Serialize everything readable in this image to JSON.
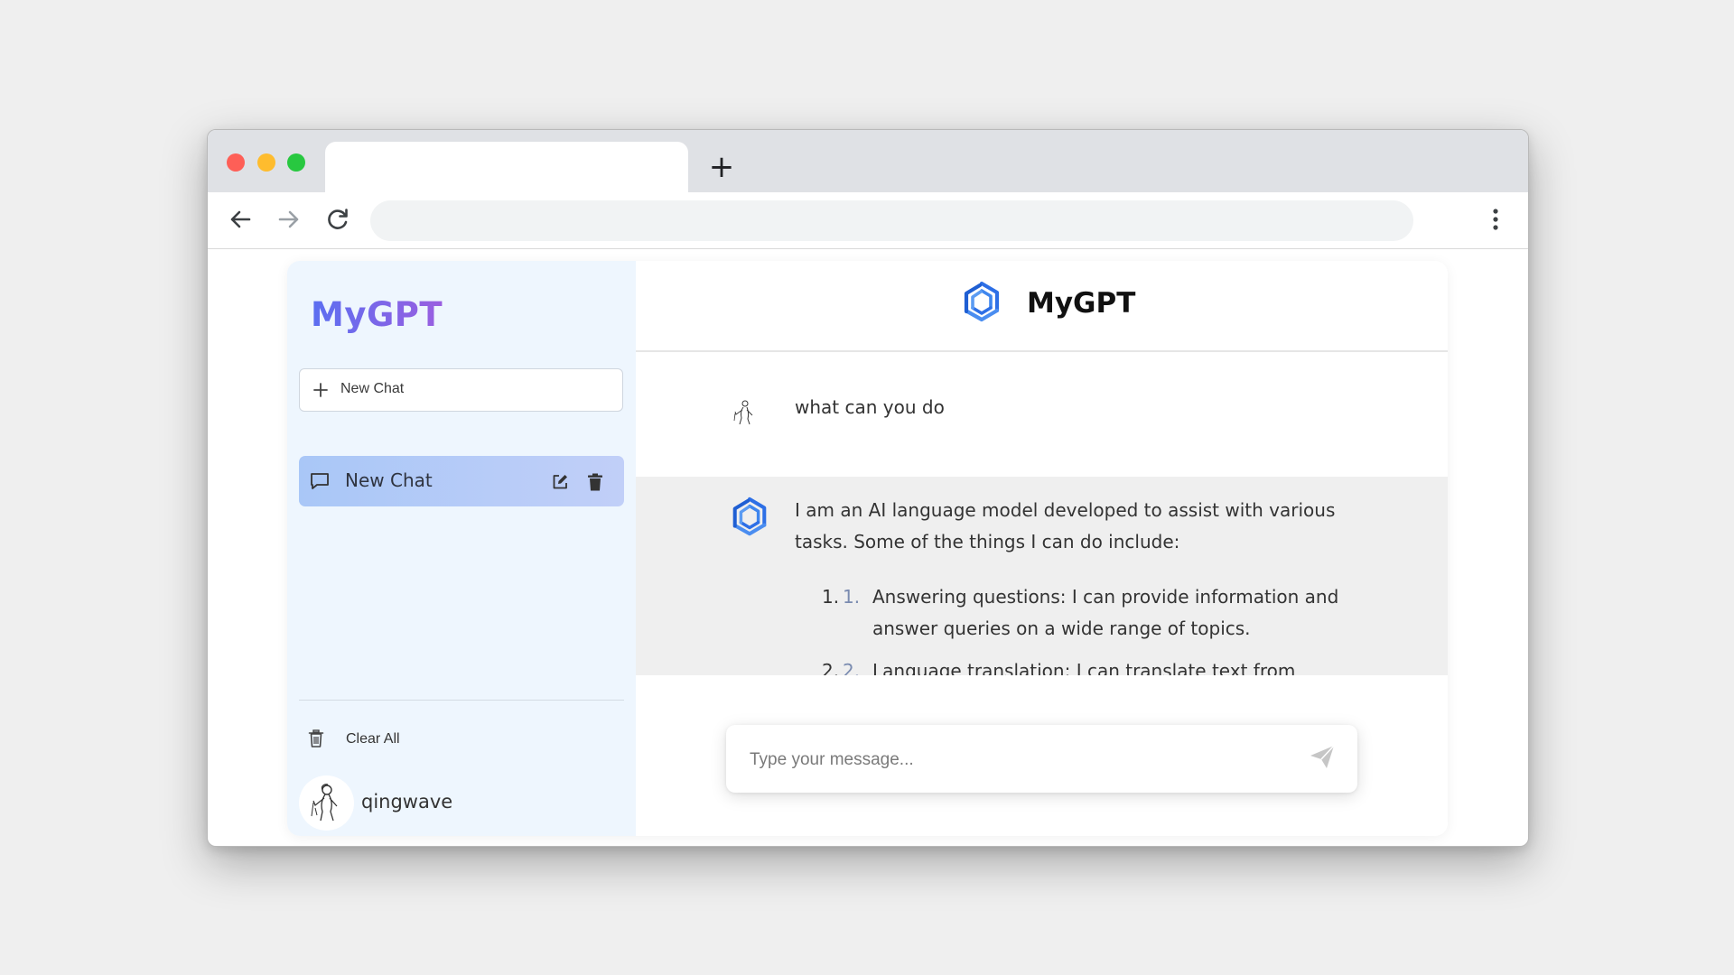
{
  "browser": {
    "new_tab_symbol": "+",
    "colors": {
      "close": "#fe5f57",
      "minimize": "#febc2e",
      "maximize": "#28c840"
    }
  },
  "sidebar": {
    "brand_title": "MyGPT",
    "new_chat_label": "New Chat",
    "chats": [
      {
        "label": "New Chat",
        "active": true,
        "actions": [
          "edit-icon",
          "trash-icon"
        ]
      }
    ],
    "clear_all_label": "Clear All",
    "user": {
      "name": "qingwave",
      "avatar_icon": "sketch-figure-avatar"
    }
  },
  "header": {
    "title": "MyGPT",
    "logo_icon": "hexagon-swirl-logo"
  },
  "conversation": {
    "user_message": "what can you do",
    "bot_message": {
      "intro": "I am an AI language model developed to assist with various tasks. Some of the things I can do include:",
      "list_items": [
        {
          "marker": "1.",
          "marker_inner": "1.",
          "text": "Answering questions: I can provide information and answer queries on a wide range of topics."
        },
        {
          "marker": "2.",
          "marker_inner": "2.",
          "text": "Language translation: I can translate text from"
        }
      ]
    }
  },
  "composer": {
    "placeholder": "Type your message...",
    "send_icon": "paper-plane-icon"
  },
  "colors": {
    "brand_gradient_start": "#5b6ff1",
    "brand_gradient_end": "#9a5ee0",
    "active_chat_bg": "#a9c7f7",
    "sidebar_bg": "#eef6fe",
    "logo_blue": "#2d6fe6",
    "bot_bg": "#efefef"
  }
}
